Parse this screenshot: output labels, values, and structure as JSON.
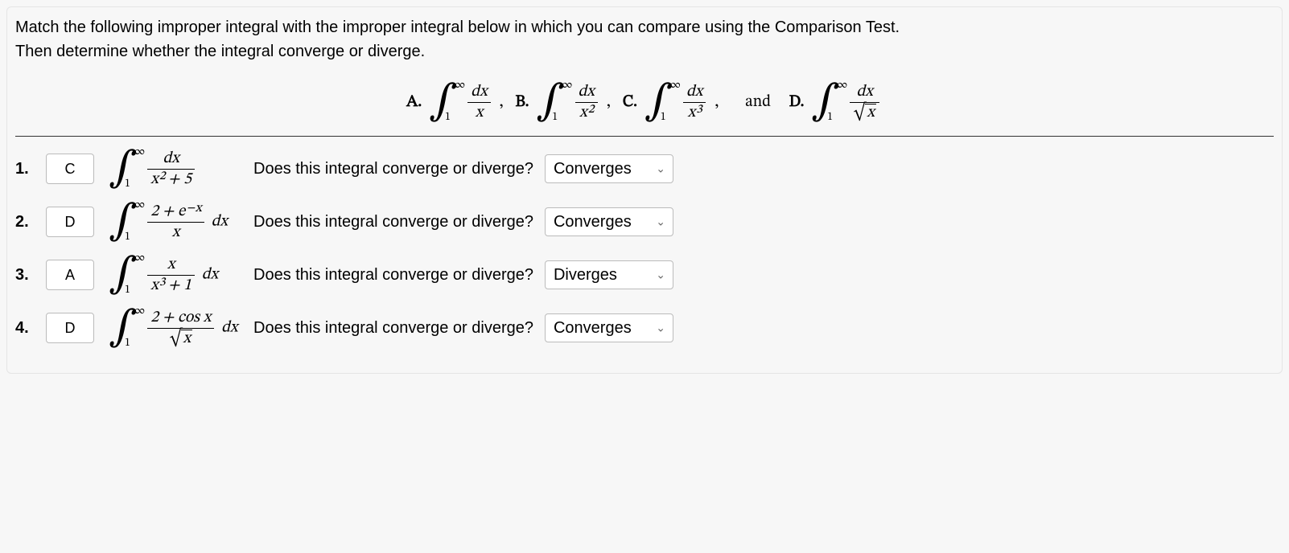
{
  "intro_line1": "Match the following improper integral with the improper integral below in which you can compare using the Comparison Test.",
  "intro_line2": "Then determine whether the integral converge or diverge.",
  "options": {
    "A_label": "A.",
    "B_label": "B.",
    "C_label": "C.",
    "D_label": "D.",
    "and_word": "and",
    "int_lower": "1",
    "int_upper": "∞",
    "dx": "dx",
    "A_num": "dx",
    "A_den": "x",
    "B_num": "dx",
    "B_den": "x²",
    "C_num": "dx",
    "C_den": "x³",
    "D_num": "dx",
    "D_den_inner": "x",
    "comma": ","
  },
  "question_text": "Does this integral converge or diverge?",
  "dropdown_options": [
    "Converges",
    "Diverges"
  ],
  "rows": [
    {
      "num": "1.",
      "answer": "C",
      "int_lower": "1",
      "int_upper": "∞",
      "frac_num": "dx",
      "frac_den": "x² + 5",
      "trailing_dx": "",
      "selected": "Converges"
    },
    {
      "num": "2.",
      "answer": "D",
      "int_lower": "1",
      "int_upper": "∞",
      "frac_num": "2 + e⁻ˣ",
      "frac_den": "x",
      "trailing_dx": "dx",
      "selected": "Converges"
    },
    {
      "num": "3.",
      "answer": "A",
      "int_lower": "1",
      "int_upper": "∞",
      "frac_num": "x",
      "frac_den": "x³ + 1",
      "trailing_dx": "dx",
      "selected": "Diverges"
    },
    {
      "num": "4.",
      "answer": "D",
      "int_lower": "1",
      "int_upper": "∞",
      "frac_num": "2 + cos x",
      "frac_den_sqrt_inner": "x",
      "trailing_dx": "dx",
      "selected": "Converges"
    }
  ]
}
